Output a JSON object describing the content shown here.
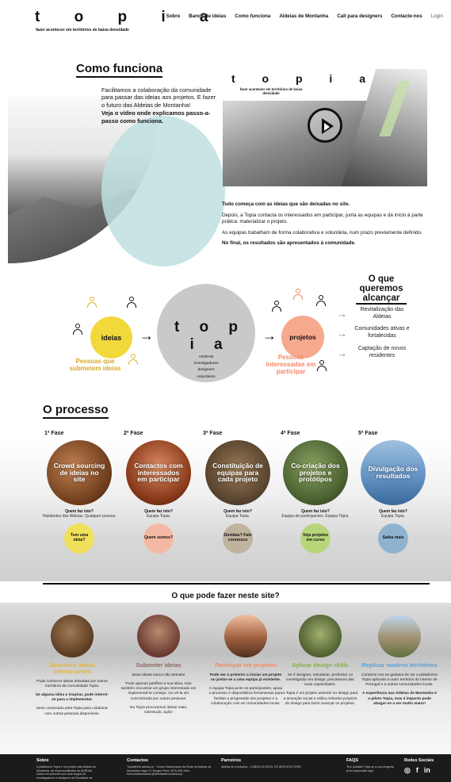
{
  "header": {
    "logo_word": "t o p i a",
    "logo_sub": "fazer acontecer em territórios de baixa densidade",
    "nav": [
      "Sobre",
      "Banco de ideias",
      "Como funciona",
      "Aldeias de Montanha",
      "Call para designers",
      "Contacte-nos"
    ],
    "login": "Login"
  },
  "como_funciona": {
    "title": "Como funciona",
    "intro": "Facilitamos a colaboração da comunidade para passar das ideias aos projetos. E fazer o futuro das Aldeias de Montanha!",
    "intro_bold": "Veja o vídeo onde explicamos passo-a-passo como funciona.",
    "video_logo": "t o p i a",
    "video_sub": "fazer acontecer em territórios de baixa densidade",
    "steps": [
      "Tudo começa com as ideias que são deixadas no site.",
      "Depois, a Topia contacta os interessados em participar, junta as equipas e dá início à parte prática: materializar o projeto.",
      "As equipas trabalham de forma colaborativa e voluntária, num prazo previamente definido.",
      "No final, os resultados são apresentados à comunidade."
    ]
  },
  "diagram": {
    "ideias": "ideias",
    "topia": "t o p i a",
    "topia_sub": [
      "ADIRAM",
      "investigadores",
      "designers",
      "voluntários"
    ],
    "projetos": "projetos",
    "label_ideias": "Pessoas que submetem ideias",
    "label_projetos": "Pessoas interessadas em participar",
    "objective_title": "O que queremos alcançar",
    "objectives": [
      "Revitalização das Aldeias",
      "Comunidades ativas e fortalecidas",
      "Captação de novos residentes"
    ]
  },
  "processo": {
    "title": "O processo",
    "who_label": "Quem faz isto?",
    "phases": [
      {
        "fase": "1ª Fase",
        "title": "Crowd sourcing de ideias no site",
        "who": "Habitantes das Aldeias. Qualquer pessoa.",
        "button": "Tem uma ideia?",
        "color": "#f1e05a"
      },
      {
        "fase": "2ª Fase",
        "title": "Contactos com interessados em participar",
        "who": "Equipa Topia.",
        "button": "Quem somos?",
        "color": "#f4b9a4"
      },
      {
        "fase": "3ª Fase",
        "title": "Constituição de equipas para cada projeto",
        "who": "Equipa Topia.",
        "button": "Dúvidas? Fale connosco",
        "color": "#bfb39d"
      },
      {
        "fase": "4ª Fase",
        "title": "Co-criação dos projetos e protótipos",
        "who": "Equipa de participantes. Equipa Topia.",
        "button": "Veja projetos em curso",
        "color": "#b7d67a"
      },
      {
        "fase": "5ª Fase",
        "title": "Divulgação dos resultados",
        "who": "Equipa Topia.",
        "button": "Saiba mais",
        "color": "#8fb3cf"
      }
    ]
  },
  "site": {
    "title": "O que pode fazer neste site?",
    "actions": [
      {
        "title": "Descobrir ideias interessantes",
        "color": "#e3b43a",
        "desc": "Pode conhecer ideias deixadas por outros membros da comunidade Topia.",
        "desc2": "Se alguma ideia o inspirar, pode intervir-se para a implementar.",
        "desc3": "Será contactado pela Topia para colaborar com outras pessoas disponíveis."
      },
      {
        "title": "Submeter ideias",
        "color": "#8a6b66",
        "desc": "Boas ideias nunca são demais!",
        "desc2": "Pode apenas partilhar a sua ideia, mas também encontrar um grupo interessado em implementá-la consigo. Ou vê-la ser concretizada por outras pessoas.",
        "desc3": "Na Topia procuramos ideias mais, sobretudo, ação!"
      },
      {
        "title": "Participar em projetos",
        "color": "#f08a64",
        "desc": "Pode ser o primeiro a iniciar um projeto ou juntar-se a uma equipa já existente.",
        "desc2": "A equipa Topia junto os participantes, apoia o processo e disponibiliza ferramentas para facilitar a progressão dos projetos e a colaboração com as comunidades locais.",
        "desc3": ""
      },
      {
        "title": "Aplicar design skills",
        "color": "#7fb04a",
        "desc": "Se é designer, estudante, professor ou investigador em design, precisamos das suas capacidades.",
        "desc2": "A Topia é um projeto assente no design para a inovação social e utiliza métodos próprios do design para fazer avançar os projetos.",
        "desc3": ""
      },
      {
        "title": "Replicar noutros territórios",
        "color": "#5a9fd0",
        "desc": "Contacte-nos se gostava de ver a plataforma Topia aplicada a outro território do interior de Portugal e a outras comunidades locais.",
        "desc2": "A experiência nas Aldeias de Montanha é o piloto Topia, mas é impacto pode alargar-se a ser muito maior!",
        "desc3": ""
      }
    ]
  },
  "footer": {
    "cols": [
      {
        "title": "Sobre",
        "text": "A plataforma Topia é um projeto das Aldeias de Montanha, da responsabilidade da ADIRAM, criado em parceria com uma equipa de investigadores e designers da Faculdade de"
      },
      {
        "title": "Contactos",
        "text": "Topia@info.adiram.pt · Centro Dinamizador da Rede de Aldeias de Montanha Largo Dr. Borges Pires, 6370-484 Seia · bernicadinamizador@aldeiasdemontanha.pt"
      },
      {
        "title": "Parceiros",
        "text": "aldeias de montanha · LISBON SCHOOL OF ARCHITECTURE"
      },
      {
        "title": "FAQS",
        "text": "Tem dúvidas? Veja se a sua pergunta já foi respondida aqui."
      },
      {
        "title": "Redes Sociais",
        "text": ""
      }
    ],
    "social_icons": [
      "instagram-icon",
      "facebook-icon",
      "linkedin-icon"
    ]
  }
}
